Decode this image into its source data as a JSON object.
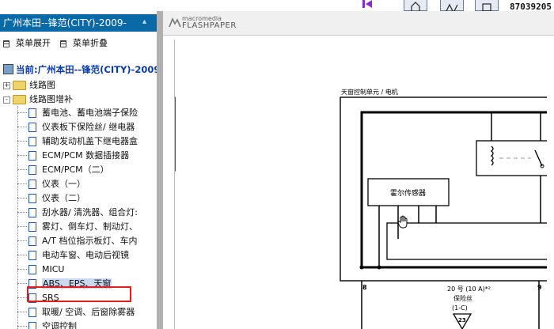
{
  "top_toolbar": {
    "right_text": "87039205"
  },
  "left_panel": {
    "title": "广州本田--锋范(CITY)-2009-",
    "expand_all": "菜单展开",
    "collapse_all": "菜单折叠",
    "current": "当前:广州本田--锋范(CITY)-2009",
    "tree": [
      {
        "label": "线路图",
        "expander": "+"
      },
      {
        "label": "线路图增补",
        "expander": "-"
      }
    ],
    "items": [
      "蓄电池、蓄电池端子保险",
      "仪表板下保险丝/ 继电器",
      "辅助发动机盖下继电器盒",
      "ECM/PCM 数据插接器",
      "ECM/PCM（二）",
      "仪表（一）",
      "仪表（二）",
      "刮水器/ 清洗器、组合灯:",
      "雾灯、倒车灯、制动灯、",
      "A/T 档位指示板灯、车内",
      "电动车窗、电动后视镜",
      "MICU",
      "ABS、EPS、天窗",
      "SRS",
      "取暖/ 空调、后窗除雾器",
      "空调控制"
    ],
    "selected_index": 12
  },
  "viewer": {
    "brand_top": "macromedia",
    "brand_bottom": "FLASHPAPER",
    "diagram": {
      "unit_label": "天窗控制单元 / 电机",
      "sensor_label": "霍尔传感器",
      "pin_left": "8",
      "pin_right": "9",
      "fuse_line1": "20 号 (10 A)*²",
      "fuse_line2": "保险丝",
      "fuse_line3": "(1-C)",
      "connector_num": "23"
    }
  }
}
